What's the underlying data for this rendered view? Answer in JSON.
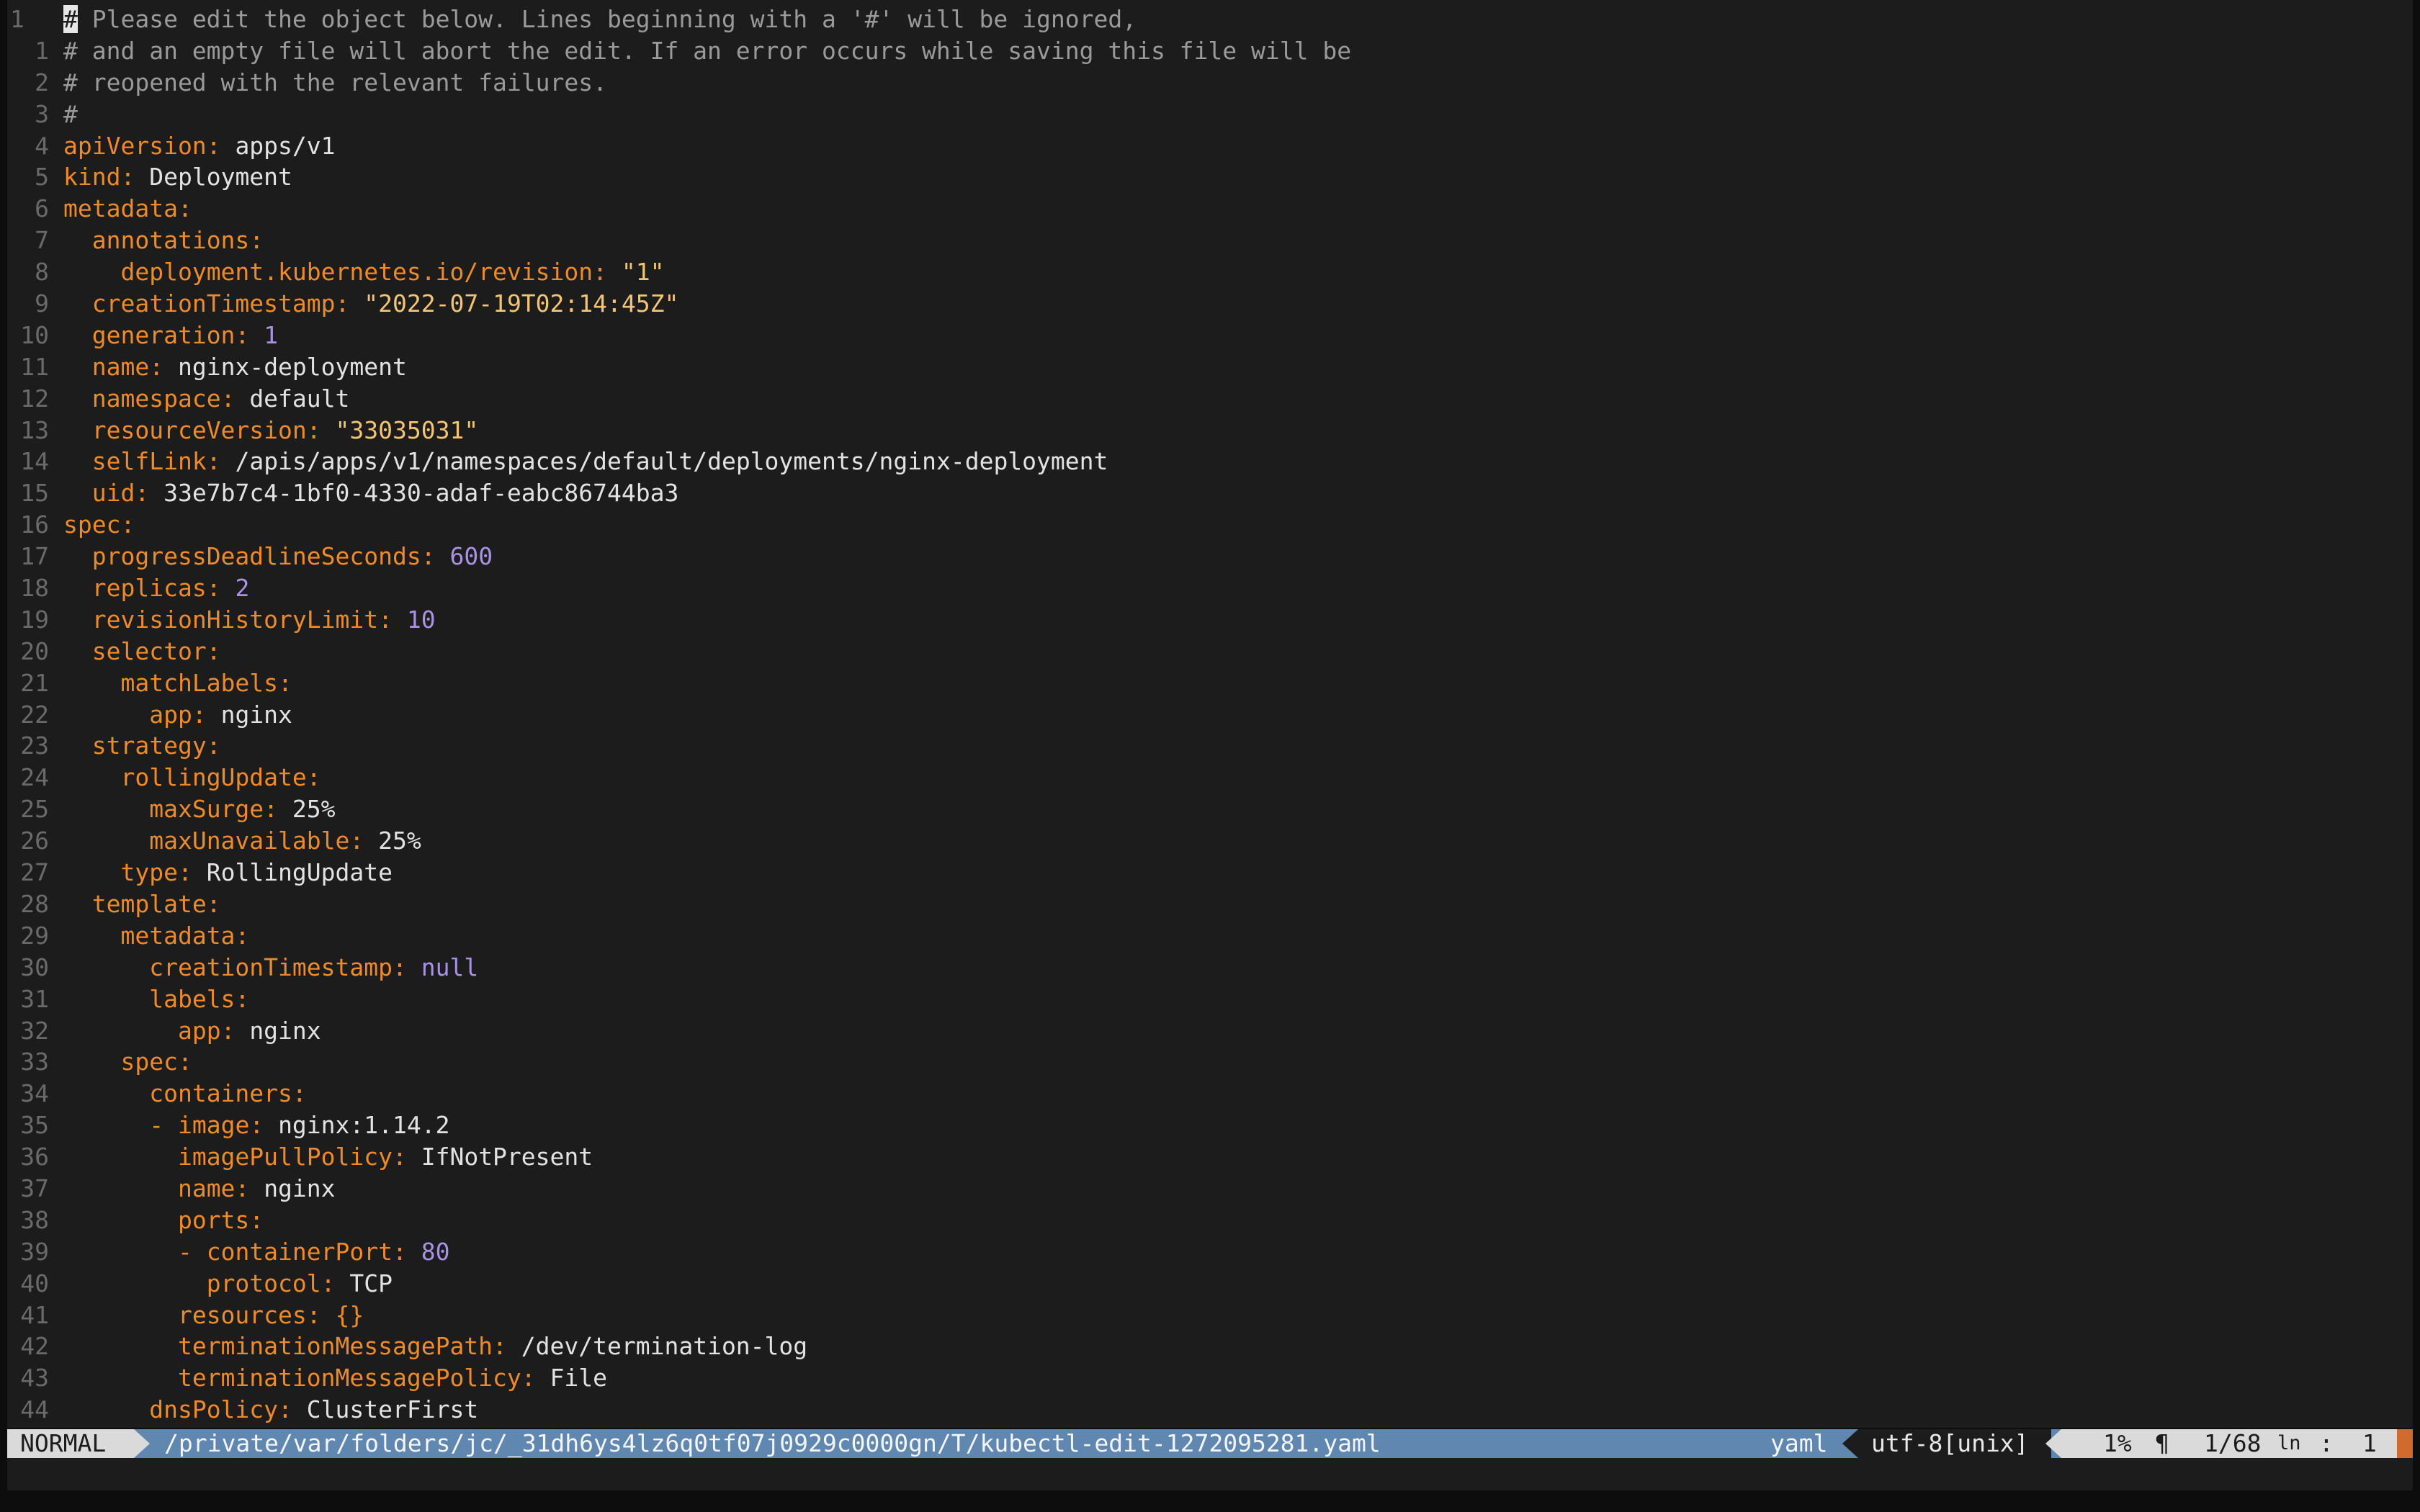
{
  "editor": {
    "lines": [
      {
        "num": "1",
        "current": true,
        "tokens": [
          [
            "cursor",
            "#"
          ],
          [
            "c",
            " Please edit the object below. Lines beginning with a '#' will be ignored,"
          ]
        ]
      },
      {
        "num": "1",
        "tokens": [
          [
            "c",
            "# and an empty file will abort the edit. If an error occurs while saving this file will be"
          ]
        ]
      },
      {
        "num": "2",
        "tokens": [
          [
            "c",
            "# reopened with the relevant failures."
          ]
        ]
      },
      {
        "num": "3",
        "tokens": [
          [
            "c",
            "#"
          ]
        ]
      },
      {
        "num": "4",
        "tokens": [
          [
            "k",
            "apiVersion"
          ],
          [
            "k",
            ": "
          ],
          [
            "v",
            "apps/v1"
          ]
        ]
      },
      {
        "num": "5",
        "tokens": [
          [
            "k",
            "kind"
          ],
          [
            "k",
            ": "
          ],
          [
            "v",
            "Deployment"
          ]
        ]
      },
      {
        "num": "6",
        "tokens": [
          [
            "k",
            "metadata"
          ],
          [
            "k",
            ":"
          ]
        ]
      },
      {
        "num": "7",
        "tokens": [
          [
            "v",
            "  "
          ],
          [
            "k",
            "annotations"
          ],
          [
            "k",
            ":"
          ]
        ]
      },
      {
        "num": "8",
        "tokens": [
          [
            "v",
            "    "
          ],
          [
            "k",
            "deployment.kubernetes.io/revision"
          ],
          [
            "k",
            ": "
          ],
          [
            "s",
            "\"1\""
          ]
        ]
      },
      {
        "num": "9",
        "tokens": [
          [
            "v",
            "  "
          ],
          [
            "k",
            "creationTimestamp"
          ],
          [
            "k",
            ": "
          ],
          [
            "s",
            "\"2022-07-19T02:14:45Z\""
          ]
        ]
      },
      {
        "num": "10",
        "tokens": [
          [
            "v",
            "  "
          ],
          [
            "k",
            "generation"
          ],
          [
            "k",
            ": "
          ],
          [
            "n",
            "1"
          ]
        ]
      },
      {
        "num": "11",
        "tokens": [
          [
            "v",
            "  "
          ],
          [
            "k",
            "name"
          ],
          [
            "k",
            ": "
          ],
          [
            "v",
            "nginx-deployment"
          ]
        ]
      },
      {
        "num": "12",
        "tokens": [
          [
            "v",
            "  "
          ],
          [
            "k",
            "namespace"
          ],
          [
            "k",
            ": "
          ],
          [
            "v",
            "default"
          ]
        ]
      },
      {
        "num": "13",
        "tokens": [
          [
            "v",
            "  "
          ],
          [
            "k",
            "resourceVersion"
          ],
          [
            "k",
            ": "
          ],
          [
            "s",
            "\"33035031\""
          ]
        ]
      },
      {
        "num": "14",
        "tokens": [
          [
            "v",
            "  "
          ],
          [
            "k",
            "selfLink"
          ],
          [
            "k",
            ": "
          ],
          [
            "v",
            "/apis/apps/v1/namespaces/default/deployments/nginx-deployment"
          ]
        ]
      },
      {
        "num": "15",
        "tokens": [
          [
            "v",
            "  "
          ],
          [
            "k",
            "uid"
          ],
          [
            "k",
            ": "
          ],
          [
            "v",
            "33e7b7c4-1bf0-4330-adaf-eabc86744ba3"
          ]
        ]
      },
      {
        "num": "16",
        "tokens": [
          [
            "k",
            "spec"
          ],
          [
            "k",
            ":"
          ]
        ]
      },
      {
        "num": "17",
        "tokens": [
          [
            "v",
            "  "
          ],
          [
            "k",
            "progressDeadlineSeconds"
          ],
          [
            "k",
            ": "
          ],
          [
            "n",
            "600"
          ]
        ]
      },
      {
        "num": "18",
        "tokens": [
          [
            "v",
            "  "
          ],
          [
            "k",
            "replicas"
          ],
          [
            "k",
            ": "
          ],
          [
            "n",
            "2"
          ]
        ]
      },
      {
        "num": "19",
        "tokens": [
          [
            "v",
            "  "
          ],
          [
            "k",
            "revisionHistoryLimit"
          ],
          [
            "k",
            ": "
          ],
          [
            "n",
            "10"
          ]
        ]
      },
      {
        "num": "20",
        "tokens": [
          [
            "v",
            "  "
          ],
          [
            "k",
            "selector"
          ],
          [
            "k",
            ":"
          ]
        ]
      },
      {
        "num": "21",
        "tokens": [
          [
            "v",
            "    "
          ],
          [
            "k",
            "matchLabels"
          ],
          [
            "k",
            ":"
          ]
        ]
      },
      {
        "num": "22",
        "tokens": [
          [
            "v",
            "      "
          ],
          [
            "k",
            "app"
          ],
          [
            "k",
            ": "
          ],
          [
            "v",
            "nginx"
          ]
        ]
      },
      {
        "num": "23",
        "tokens": [
          [
            "v",
            "  "
          ],
          [
            "k",
            "strategy"
          ],
          [
            "k",
            ":"
          ]
        ]
      },
      {
        "num": "24",
        "tokens": [
          [
            "v",
            "    "
          ],
          [
            "k",
            "rollingUpdate"
          ],
          [
            "k",
            ":"
          ]
        ]
      },
      {
        "num": "25",
        "tokens": [
          [
            "v",
            "      "
          ],
          [
            "k",
            "maxSurge"
          ],
          [
            "k",
            ": "
          ],
          [
            "v",
            "25%"
          ]
        ]
      },
      {
        "num": "26",
        "tokens": [
          [
            "v",
            "      "
          ],
          [
            "k",
            "maxUnavailable"
          ],
          [
            "k",
            ": "
          ],
          [
            "v",
            "25%"
          ]
        ]
      },
      {
        "num": "27",
        "tokens": [
          [
            "v",
            "    "
          ],
          [
            "k",
            "type"
          ],
          [
            "k",
            ": "
          ],
          [
            "v",
            "RollingUpdate"
          ]
        ]
      },
      {
        "num": "28",
        "tokens": [
          [
            "v",
            "  "
          ],
          [
            "k",
            "template"
          ],
          [
            "k",
            ":"
          ]
        ]
      },
      {
        "num": "29",
        "tokens": [
          [
            "v",
            "    "
          ],
          [
            "k",
            "metadata"
          ],
          [
            "k",
            ":"
          ]
        ]
      },
      {
        "num": "30",
        "tokens": [
          [
            "v",
            "      "
          ],
          [
            "k",
            "creationTimestamp"
          ],
          [
            "k",
            ": "
          ],
          [
            "n",
            "null"
          ]
        ]
      },
      {
        "num": "31",
        "tokens": [
          [
            "v",
            "      "
          ],
          [
            "k",
            "labels"
          ],
          [
            "k",
            ":"
          ]
        ]
      },
      {
        "num": "32",
        "tokens": [
          [
            "v",
            "        "
          ],
          [
            "k",
            "app"
          ],
          [
            "k",
            ": "
          ],
          [
            "v",
            "nginx"
          ]
        ]
      },
      {
        "num": "33",
        "tokens": [
          [
            "v",
            "    "
          ],
          [
            "k",
            "spec"
          ],
          [
            "k",
            ":"
          ]
        ]
      },
      {
        "num": "34",
        "tokens": [
          [
            "v",
            "      "
          ],
          [
            "k",
            "containers"
          ],
          [
            "k",
            ":"
          ]
        ]
      },
      {
        "num": "35",
        "tokens": [
          [
            "v",
            "      "
          ],
          [
            "k",
            "- "
          ],
          [
            "k",
            "image"
          ],
          [
            "k",
            ": "
          ],
          [
            "v",
            "nginx:1.14.2"
          ]
        ]
      },
      {
        "num": "36",
        "tokens": [
          [
            "v",
            "        "
          ],
          [
            "k",
            "imagePullPolicy"
          ],
          [
            "k",
            ": "
          ],
          [
            "v",
            "IfNotPresent"
          ]
        ]
      },
      {
        "num": "37",
        "tokens": [
          [
            "v",
            "        "
          ],
          [
            "k",
            "name"
          ],
          [
            "k",
            ": "
          ],
          [
            "v",
            "nginx"
          ]
        ]
      },
      {
        "num": "38",
        "tokens": [
          [
            "v",
            "        "
          ],
          [
            "k",
            "ports"
          ],
          [
            "k",
            ":"
          ]
        ]
      },
      {
        "num": "39",
        "tokens": [
          [
            "v",
            "        "
          ],
          [
            "k",
            "- "
          ],
          [
            "k",
            "containerPort"
          ],
          [
            "k",
            ": "
          ],
          [
            "n",
            "80"
          ]
        ]
      },
      {
        "num": "40",
        "tokens": [
          [
            "v",
            "          "
          ],
          [
            "k",
            "protocol"
          ],
          [
            "k",
            ": "
          ],
          [
            "v",
            "TCP"
          ]
        ]
      },
      {
        "num": "41",
        "tokens": [
          [
            "v",
            "        "
          ],
          [
            "k",
            "resources"
          ],
          [
            "k",
            ": "
          ],
          [
            "k",
            "{}"
          ]
        ]
      },
      {
        "num": "42",
        "tokens": [
          [
            "v",
            "        "
          ],
          [
            "k",
            "terminationMessagePath"
          ],
          [
            "k",
            ": "
          ],
          [
            "v",
            "/dev/termination-log"
          ]
        ]
      },
      {
        "num": "43",
        "tokens": [
          [
            "v",
            "        "
          ],
          [
            "k",
            "terminationMessagePolicy"
          ],
          [
            "k",
            ": "
          ],
          [
            "v",
            "File"
          ]
        ]
      },
      {
        "num": "44",
        "tokens": [
          [
            "v",
            "      "
          ],
          [
            "k",
            "dnsPolicy"
          ],
          [
            "k",
            ": "
          ],
          [
            "v",
            "ClusterFirst"
          ]
        ]
      }
    ]
  },
  "statusline": {
    "mode": "NORMAL",
    "path": "/private/var/folders/jc/_31dh6ys4lz6q0tf07j0929c0000gn/T/kubectl-edit-1272095281.yaml",
    "filetype": "yaml",
    "encoding": "utf-8[unix]",
    "percent": "1%",
    "para_symbol": "¶",
    "line_position": "1/68",
    "ln_label": "ln",
    "colon": ":",
    "column": "1"
  },
  "colors": {
    "key": "#ee8a2a",
    "comment": "#9a9a9a",
    "string": "#f2c474",
    "number": "#a891e6",
    "value": "#e2e2e2",
    "statusline_bg": "#5f87af",
    "mode_bg": "#dadada",
    "editor_bg": "#1c1c1c"
  }
}
